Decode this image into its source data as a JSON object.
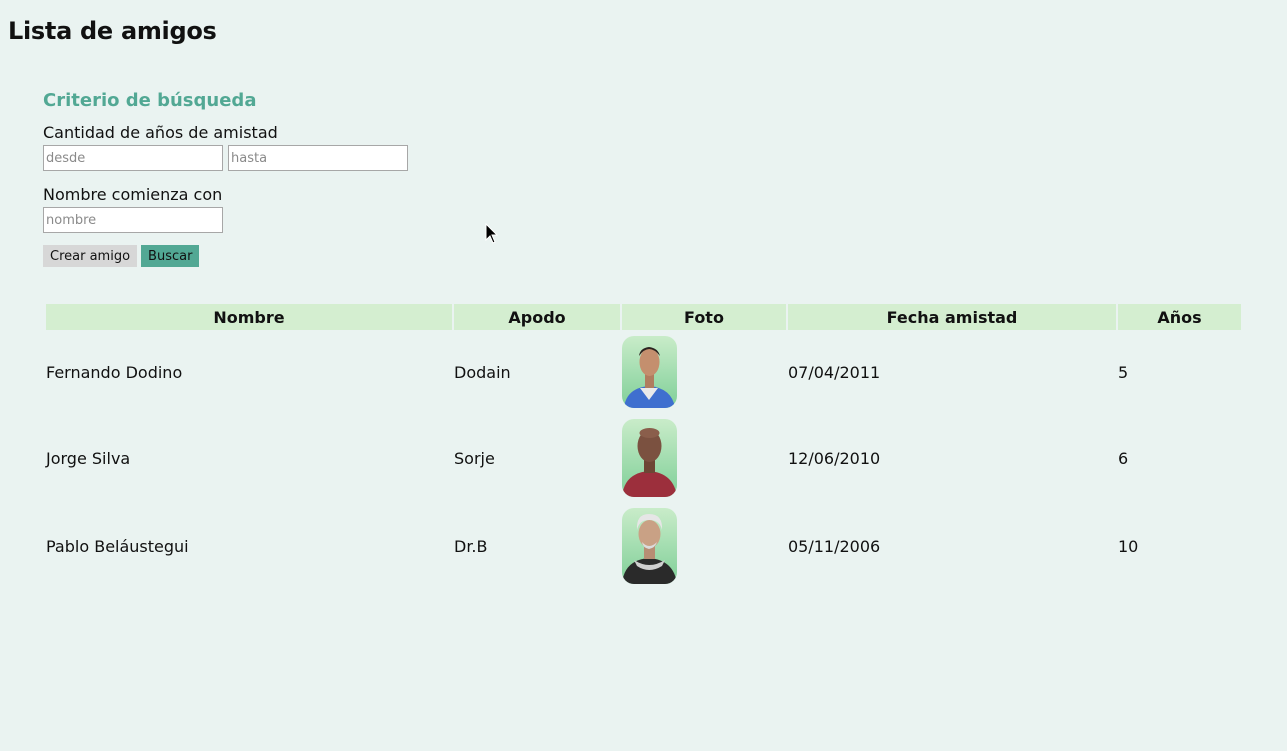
{
  "page": {
    "title": "Lista de amigos"
  },
  "search": {
    "title": "Criterio de búsqueda",
    "years_label": "Cantidad de años de amistad",
    "from_placeholder": "desde",
    "to_placeholder": "hasta",
    "name_label": "Nombre comienza con",
    "name_placeholder": "nombre",
    "create_button": "Crear amigo",
    "search_button": "Buscar"
  },
  "table": {
    "headers": [
      "Nombre",
      "Apodo",
      "Foto",
      "Fecha amistad",
      "Años"
    ],
    "rows": [
      {
        "nombre": "Fernando Dodino",
        "apodo": "Dodain",
        "fecha": "07/04/2011",
        "anios": "5"
      },
      {
        "nombre": "Jorge Silva",
        "apodo": "Sorje",
        "fecha": "12/06/2010",
        "anios": "6"
      },
      {
        "nombre": "Pablo Beláustegui",
        "apodo": "Dr.B",
        "fecha": "05/11/2006",
        "anios": "10"
      }
    ]
  },
  "colors": {
    "accent": "#52a894",
    "header_bg": "#d4eed0",
    "page_bg": "#eaf3f1"
  }
}
